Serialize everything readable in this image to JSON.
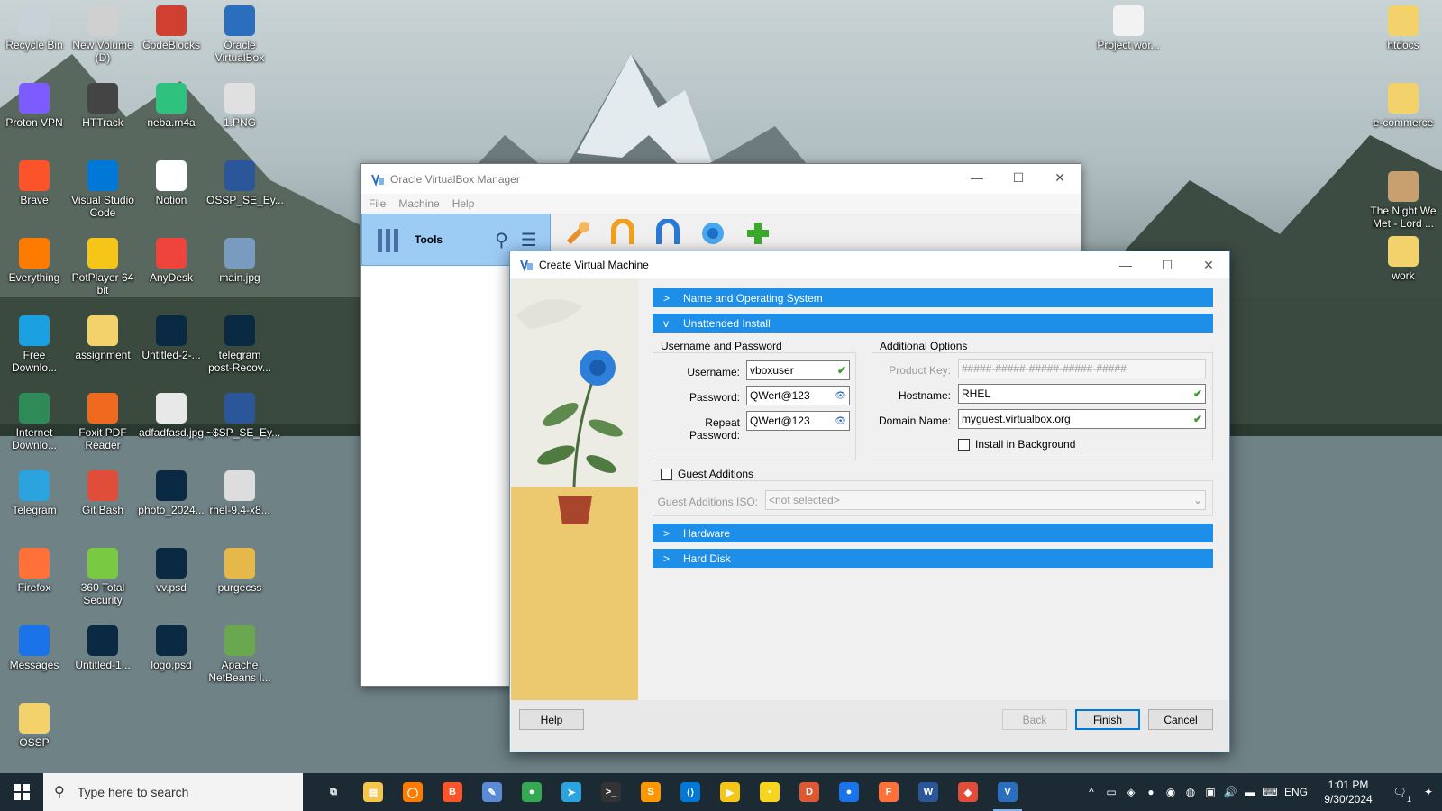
{
  "desktop": {
    "left_icons": [
      {
        "label": "Recycle Bin",
        "icon": "recycle-bin-icon",
        "color": "#c8d0d8"
      },
      {
        "label": "New Volume (D)",
        "icon": "drive-icon",
        "color": "#d0d0d0"
      },
      {
        "label": "CodeBlocks",
        "icon": "codeblocks-icon",
        "color": "#d04030"
      },
      {
        "label": "Oracle VirtualBox",
        "icon": "virtualbox-icon",
        "color": "#2a6ebd"
      },
      {
        "label": "Proton VPN",
        "icon": "protonvpn-icon",
        "color": "#7c5cff"
      },
      {
        "label": "HTTrack",
        "icon": "httrack-icon",
        "color": "#444444"
      },
      {
        "label": "neba.m4a",
        "icon": "media-icon",
        "color": "#2ec27e"
      },
      {
        "label": "1.PNG",
        "icon": "image-file-icon",
        "color": "#e0e0e0"
      },
      {
        "label": "Brave",
        "icon": "brave-icon",
        "color": "#fb542b"
      },
      {
        "label": "Visual Studio Code",
        "icon": "vscode-icon",
        "color": "#0078d7"
      },
      {
        "label": "Notion",
        "icon": "notion-icon",
        "color": "#ffffff"
      },
      {
        "label": "OSSP_SE_Ey...",
        "icon": "word-doc-icon",
        "color": "#2b579a"
      },
      {
        "label": "Everything",
        "icon": "everything-icon",
        "color": "#ff7b00"
      },
      {
        "label": "PotPlayer 64 bit",
        "icon": "potplayer-icon",
        "color": "#f5c518"
      },
      {
        "label": "AnyDesk",
        "icon": "anydesk-icon",
        "color": "#ef443b"
      },
      {
        "label": "main.jpg",
        "icon": "photo-icon",
        "color": "#7a9bc0"
      },
      {
        "label": "Free Downlo...",
        "icon": "fdm-icon",
        "color": "#1ba1e2"
      },
      {
        "label": "assignment",
        "icon": "folder-icon",
        "color": "#f3d26b"
      },
      {
        "label": "Untitled-2-...",
        "icon": "psd-icon",
        "color": "#0a2a44"
      },
      {
        "label": "telegram post-Recov...",
        "icon": "psd-icon",
        "color": "#0a2a44"
      },
      {
        "label": "Internet Downlo...",
        "icon": "idm-icon",
        "color": "#2e8b57"
      },
      {
        "label": "Foxit PDF Reader",
        "icon": "foxit-icon",
        "color": "#ef6a1f"
      },
      {
        "label": "adfadfasd.jpg",
        "icon": "photo-icon",
        "color": "#e8e8e8"
      },
      {
        "label": "~$SP_SE_Ey...",
        "icon": "word-doc-icon",
        "color": "#2b579a"
      },
      {
        "label": "Telegram",
        "icon": "telegram-icon",
        "color": "#2aa3df"
      },
      {
        "label": "Git Bash",
        "icon": "gitbash-icon",
        "color": "#e04e39"
      },
      {
        "label": "photo_2024...",
        "icon": "psd-icon",
        "color": "#0a2a44"
      },
      {
        "label": "rhel-9.4-x8...",
        "icon": "disc-image-icon",
        "color": "#dddddd"
      },
      {
        "label": "Firefox",
        "icon": "firefox-icon",
        "color": "#ff7139"
      },
      {
        "label": "360 Total Security",
        "icon": "360-security-icon",
        "color": "#7ac943"
      },
      {
        "label": "vv.psd",
        "icon": "psd-icon",
        "color": "#0a2a44"
      },
      {
        "label": "purgecss",
        "icon": "folder-zip-icon",
        "color": "#e6b84a"
      },
      {
        "label": "Messages",
        "icon": "messages-icon",
        "color": "#1a73e8"
      },
      {
        "label": "Untitled-1...",
        "icon": "psd-icon",
        "color": "#0a2a44"
      },
      {
        "label": "logo.psd",
        "icon": "psd-icon",
        "color": "#0a2a44"
      },
      {
        "label": "Apache NetBeans I...",
        "icon": "netbeans-icon",
        "color": "#6aa84f"
      },
      {
        "label": "OSSP",
        "icon": "folder-icon",
        "color": "#f3d26b"
      }
    ],
    "right_icons": [
      {
        "label": "Project wor...",
        "icon": "document-icon",
        "color": "#f2f2f2"
      },
      {
        "label": "htdocs",
        "icon": "folder-icon",
        "color": "#f3d26b"
      },
      {
        "label": "e-commerce",
        "icon": "folder-icon",
        "color": "#f3d26b"
      },
      {
        "label": "The Night We Met - Lord ...",
        "icon": "music-file-icon",
        "color": "#c8a070"
      },
      {
        "label": "work",
        "icon": "folder-icon",
        "color": "#f3d26b"
      }
    ]
  },
  "manager": {
    "title": "Oracle VirtualBox Manager",
    "menu": [
      "File",
      "Machine",
      "Help"
    ],
    "tools_label": "Tools",
    "toolbar": [
      "preferences-icon",
      "import-icon",
      "export-icon",
      "new-icon",
      "add-icon"
    ]
  },
  "dialog": {
    "title": "Create Virtual Machine",
    "sections": {
      "name_os": "Name and Operating System",
      "unattended": "Unattended Install",
      "hardware": "Hardware",
      "hard_disk": "Hard Disk"
    },
    "userpass": {
      "group": "Username and Password",
      "username_label": "Username:",
      "username": "vboxuser",
      "password_label": "Password:",
      "password": "QWert@123",
      "repeat_label": "Repeat Password:",
      "repeat": "QWert@123"
    },
    "additional": {
      "group": "Additional Options",
      "product_key_label": "Product Key:",
      "product_key_placeholder": "#####-#####-#####-#####-#####",
      "hostname_label": "Hostname:",
      "hostname": "RHEL",
      "domain_label": "Domain Name:",
      "domain": "myguest.virtualbox.org",
      "install_bg": "Install in Background"
    },
    "guest": {
      "checkbox": "Guest Additions",
      "iso_label": "Guest Additions ISO:",
      "iso_value": "<not selected>"
    },
    "buttons": {
      "help": "Help",
      "back": "Back",
      "finish": "Finish",
      "cancel": "Cancel"
    }
  },
  "taskbar": {
    "search_placeholder": "Type here to search",
    "apps": [
      {
        "icon": "task-view-icon",
        "color": "#1c2a33",
        "glyph": "⧉"
      },
      {
        "icon": "file-explorer-icon",
        "color": "#f3c54b",
        "glyph": "▤"
      },
      {
        "icon": "everything-search-icon",
        "color": "#ff7b00",
        "glyph": "◯"
      },
      {
        "icon": "brave-icon",
        "color": "#fb542b",
        "glyph": "B"
      },
      {
        "icon": "paint-icon",
        "color": "#5c8bd6",
        "glyph": "✎"
      },
      {
        "icon": "chrome-icon",
        "color": "#34a853",
        "glyph": "●"
      },
      {
        "icon": "telegram-icon",
        "color": "#2aa3df",
        "glyph": "➤"
      },
      {
        "icon": "terminal-icon",
        "color": "#333333",
        "glyph": ">_"
      },
      {
        "icon": "sublime-icon",
        "color": "#ff9800",
        "glyph": "S"
      },
      {
        "icon": "vscode-icon",
        "color": "#0078d7",
        "glyph": "⟨⟩"
      },
      {
        "icon": "potplayer-icon",
        "color": "#f5c518",
        "glyph": "▶"
      },
      {
        "icon": "sticky-notes-icon",
        "color": "#f7d51c",
        "glyph": "▪"
      },
      {
        "icon": "duckduckgo-icon",
        "color": "#de5833",
        "glyph": "D"
      },
      {
        "icon": "messages-icon",
        "color": "#1a73e8",
        "glyph": "●"
      },
      {
        "icon": "firefox-icon",
        "color": "#ff7139",
        "glyph": "F"
      },
      {
        "icon": "word-icon",
        "color": "#2b579a",
        "glyph": "W"
      },
      {
        "icon": "git-icon",
        "color": "#e04e39",
        "glyph": "◆"
      },
      {
        "icon": "virtualbox-icon",
        "color": "#2a6ebd",
        "glyph": "V"
      }
    ],
    "language": "ENG",
    "time": "1:01 PM",
    "date": "9/30/2024",
    "notifications": "1"
  }
}
